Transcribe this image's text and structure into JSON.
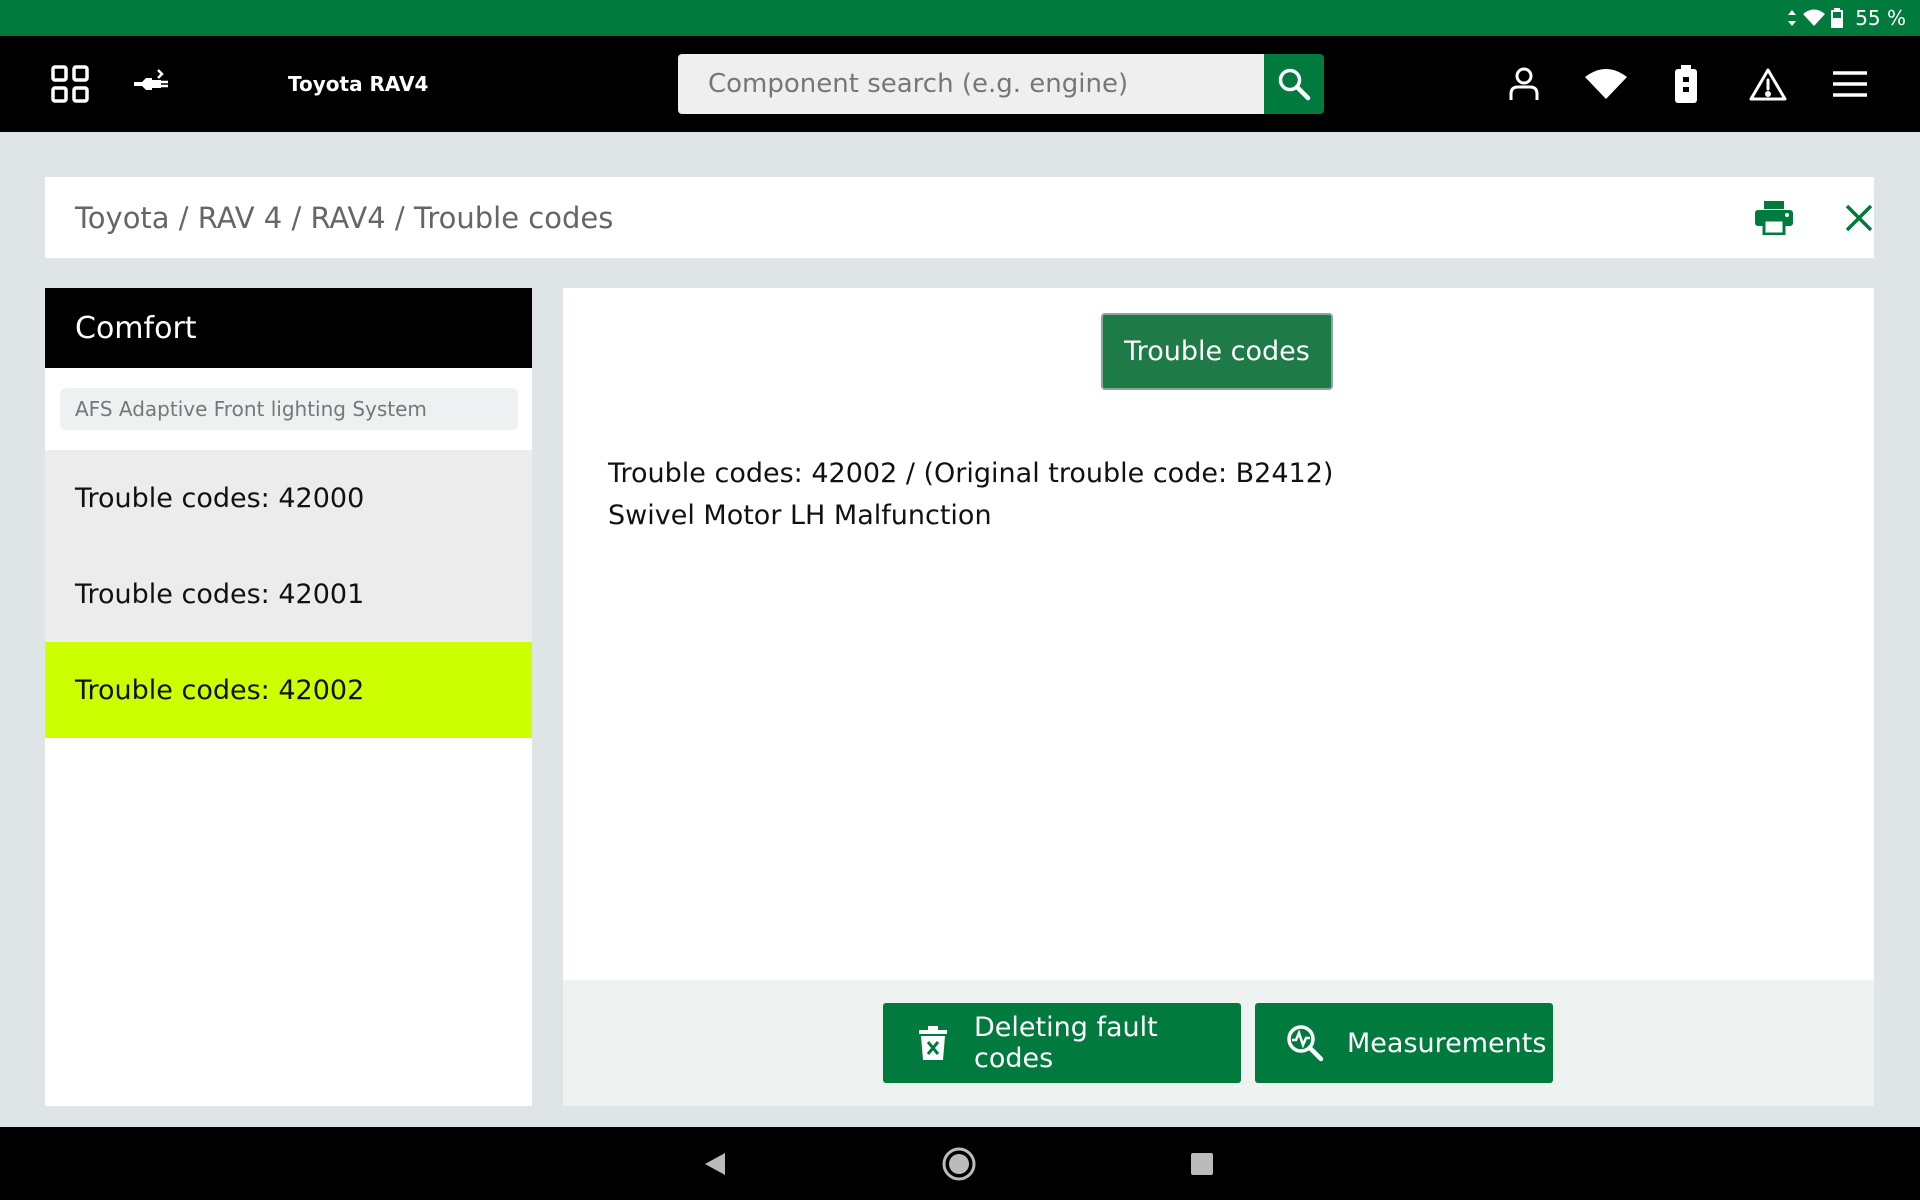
{
  "status_bar": {
    "battery_text": "55 %"
  },
  "top_bar": {
    "vehicle_title": "Toyota RAV4",
    "search": {
      "placeholder": "Component search (e.g. engine)",
      "value": ""
    },
    "icons": [
      "grid-icon",
      "plug-connection-icon",
      "search-icon",
      "user-icon",
      "wifi-icon",
      "battery-icon",
      "warning-icon",
      "menu-icon"
    ]
  },
  "breadcrumb": {
    "text": "Toyota / RAV 4 / RAV4 / Trouble codes"
  },
  "sidebar": {
    "title": "Comfort",
    "filter_text": "AFS Adaptive Front lighting System",
    "items": [
      {
        "label": "Trouble codes: 42000",
        "active": false
      },
      {
        "label": "Trouble codes: 42001",
        "active": false
      },
      {
        "label": "Trouble codes: 42002",
        "active": true
      }
    ]
  },
  "content": {
    "tab_label": "Trouble codes",
    "code_title": "Trouble codes: 42002 / (Original trouble code: B2412)",
    "code_description": "Swivel Motor LH Malfunction",
    "actions": {
      "delete_label": "Deleting fault codes",
      "measurements_label": "Measurements"
    }
  },
  "colors": {
    "brand_green": "#007a3d",
    "active_item": "#ccff00",
    "top_bar": "#000000"
  }
}
